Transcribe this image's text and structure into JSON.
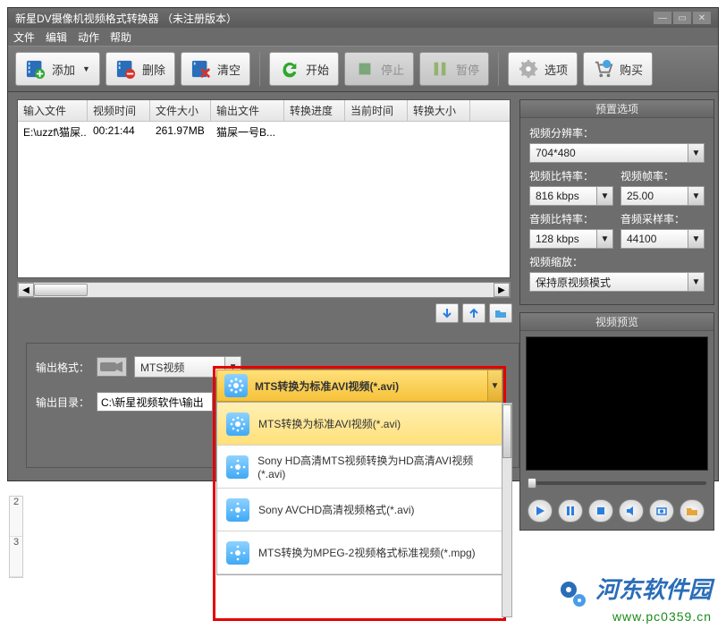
{
  "title": "新星DV摄像机视频格式转换器 （未注册版本）",
  "menu": {
    "file": "文件",
    "edit": "编辑",
    "action": "动作",
    "help": "帮助"
  },
  "toolbar": {
    "add": "添加",
    "delete": "删除",
    "clear": "清空",
    "start": "开始",
    "stop": "停止",
    "pause": "暂停",
    "options": "选项",
    "buy": "购买"
  },
  "table": {
    "headers": {
      "input": "输入文件",
      "duration": "视频时间",
      "size": "文件大小",
      "output": "输出文件",
      "progress": "转换进度",
      "current": "当前时间",
      "outsize": "转换大小"
    },
    "rows": [
      {
        "input": "E:\\uzzf\\猫屎...",
        "duration": "00:21:44",
        "size": "261.97MB",
        "output": "猫屎一号B...",
        "progress": "",
        "current": "",
        "outsize": ""
      }
    ]
  },
  "output_panel": {
    "format_label": "输出格式：",
    "format_category": "MTS视频",
    "dir_label": "输出目录：",
    "dir_value": "C:\\新星视频软件\\输出"
  },
  "format_dropdown": {
    "selected": "MTS转换为标准AVI视频(*.avi)",
    "items": [
      "MTS转换为标准AVI视频(*.avi)",
      "Sony HD高清MTS视频转换为HD高清AVI视频(*.avi)",
      "Sony AVCHD高清视频格式(*.avi)",
      "MTS转换为MPEG-2视频格式标准视频(*.mpg)"
    ]
  },
  "preset": {
    "title": "预置选项",
    "resolution_label": "视频分辨率：",
    "resolution": "704*480",
    "vbitrate_label": "视频比特率：",
    "vbitrate": "816 kbps",
    "fps_label": "视频帧率：",
    "fps": "25.00",
    "abitrate_label": "音频比特率：",
    "abitrate": "128 kbps",
    "asample_label": "音频采样率：",
    "asample": "44100",
    "zoom_label": "视频缩放：",
    "zoom": "保持原视频模式"
  },
  "preview": {
    "title": "视频预览"
  },
  "watermark": {
    "text": "河东软件园",
    "url": "www.pc0359.cn"
  },
  "ext_rows": [
    "2",
    "3"
  ]
}
